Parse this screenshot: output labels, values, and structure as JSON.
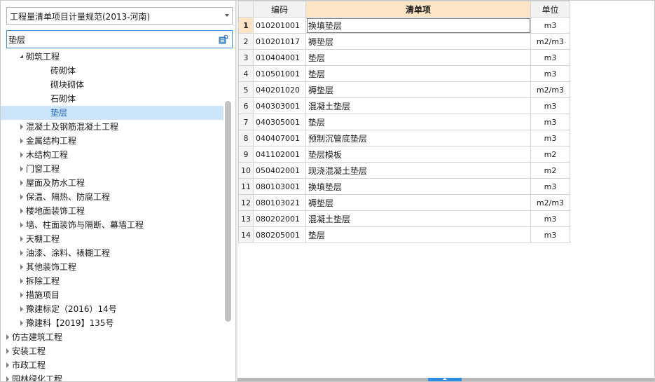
{
  "spec_selector": {
    "value": "工程量清单项目计量规范(2013-河南)"
  },
  "search": {
    "value": "垫层",
    "icon": "search-filter-icon"
  },
  "tree": [
    {
      "label": "砌筑工程",
      "level": 1,
      "state": "expanded"
    },
    {
      "label": "砖砌体",
      "level": 2,
      "state": "leaf"
    },
    {
      "label": "砌块砌体",
      "level": 2,
      "state": "leaf"
    },
    {
      "label": "石砌体",
      "level": 2,
      "state": "leaf"
    },
    {
      "label": "垫层",
      "level": 2,
      "state": "leaf",
      "selected": true
    },
    {
      "label": "混凝土及钢筋混凝土工程",
      "level": 1,
      "state": "collapsed"
    },
    {
      "label": "金属结构工程",
      "level": 1,
      "state": "collapsed"
    },
    {
      "label": "木结构工程",
      "level": 1,
      "state": "collapsed"
    },
    {
      "label": "门窗工程",
      "level": 1,
      "state": "collapsed"
    },
    {
      "label": "屋面及防水工程",
      "level": 1,
      "state": "collapsed"
    },
    {
      "label": "保温、隔热、防腐工程",
      "level": 1,
      "state": "collapsed"
    },
    {
      "label": "楼地面装饰工程",
      "level": 1,
      "state": "collapsed"
    },
    {
      "label": "墙、柱面装饰与隔断、幕墙工程",
      "level": 1,
      "state": "collapsed"
    },
    {
      "label": "天棚工程",
      "level": 1,
      "state": "collapsed"
    },
    {
      "label": "油漆、涂料、裱糊工程",
      "level": 1,
      "state": "collapsed"
    },
    {
      "label": "其他装饰工程",
      "level": 1,
      "state": "collapsed"
    },
    {
      "label": "拆除工程",
      "level": 1,
      "state": "collapsed"
    },
    {
      "label": "措施项目",
      "level": 1,
      "state": "collapsed"
    },
    {
      "label": "豫建标定（2016）14号",
      "level": 1,
      "state": "collapsed"
    },
    {
      "label": "豫建科【2019】135号",
      "level": 1,
      "state": "collapsed"
    },
    {
      "label": "仿古建筑工程",
      "level": 0,
      "state": "collapsed"
    },
    {
      "label": "安装工程",
      "level": 0,
      "state": "collapsed"
    },
    {
      "label": "市政工程",
      "level": 0,
      "state": "collapsed"
    },
    {
      "label": "园林绿化工程",
      "level": 0,
      "state": "collapsed"
    }
  ],
  "table": {
    "headers": {
      "num": "",
      "code": "编码",
      "name": "清单项",
      "unit": "单位"
    },
    "rows": [
      {
        "n": "1",
        "code": "010201001",
        "name": "换填垫层",
        "unit": "m3"
      },
      {
        "n": "2",
        "code": "010201017",
        "name": "褥垫层",
        "unit": "m2/m3"
      },
      {
        "n": "3",
        "code": "010404001",
        "name": "垫层",
        "unit": "m3"
      },
      {
        "n": "4",
        "code": "010501001",
        "name": "垫层",
        "unit": "m3"
      },
      {
        "n": "5",
        "code": "040201020",
        "name": "褥垫层",
        "unit": "m2/m3"
      },
      {
        "n": "6",
        "code": "040303001",
        "name": "混凝土垫层",
        "unit": "m3"
      },
      {
        "n": "7",
        "code": "040305001",
        "name": "垫层",
        "unit": "m3"
      },
      {
        "n": "8",
        "code": "040407001",
        "name": "预制沉管底垫层",
        "unit": "m3"
      },
      {
        "n": "9",
        "code": "041102001",
        "name": "垫层模板",
        "unit": "m2"
      },
      {
        "n": "10",
        "code": "050402001",
        "name": "现浇混凝土垫层",
        "unit": "m2"
      },
      {
        "n": "11",
        "code": "080103001",
        "name": "换填垫层",
        "unit": "m3"
      },
      {
        "n": "12",
        "code": "080103021",
        "name": "褥垫层",
        "unit": "m2/m3"
      },
      {
        "n": "13",
        "code": "080202001",
        "name": "混凝土垫层",
        "unit": "m3"
      },
      {
        "n": "14",
        "code": "080205001",
        "name": "垫层",
        "unit": "m3"
      }
    ]
  }
}
